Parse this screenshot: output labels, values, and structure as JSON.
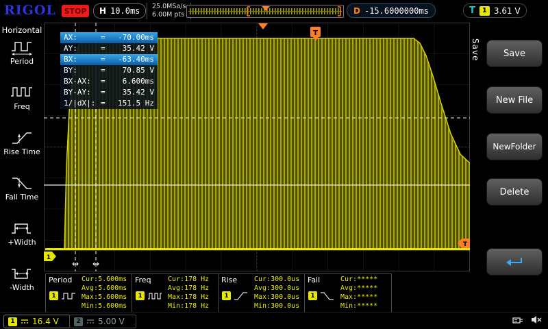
{
  "top_bar": {
    "logo": "RIGOL",
    "run_state": "STOP",
    "horizontal": {
      "label": "H",
      "timebase": "10.0ms"
    },
    "acquisition": {
      "sample_rate": "25.0MSa/s",
      "memory_depth": "6.00M pts"
    },
    "delay": {
      "label": "D",
      "value": "-15.6000000ms"
    },
    "trigger": {
      "label": "T",
      "source": "1",
      "level": "3.61 V"
    }
  },
  "left_menu": {
    "title": "Horizontal",
    "items": [
      {
        "label": "Period"
      },
      {
        "label": "Freq"
      },
      {
        "label": "Rise Time"
      },
      {
        "label": "Fall Time"
      },
      {
        "label": "+Width"
      },
      {
        "label": "-Width"
      }
    ]
  },
  "cursor_panel": {
    "rows": [
      {
        "label": "AX:",
        "eq": "=",
        "value": "-70.00ms",
        "highlight": true
      },
      {
        "label": "AY:",
        "eq": "=",
        "value": "35.42 V",
        "highlight": false
      },
      {
        "label": "BX:",
        "eq": "=",
        "value": "-63.40ms",
        "highlight": true
      },
      {
        "label": "BY:",
        "eq": "=",
        "value": "70.85 V",
        "highlight": false
      },
      {
        "label": "BX-AX:",
        "eq": "=",
        "value": "6.600ms",
        "highlight": false
      },
      {
        "label": "BY-AY:",
        "eq": "=",
        "value": "35.42 V",
        "highlight": false
      },
      {
        "label": "1/|dX|:",
        "eq": "=",
        "value": "151.5 Hz",
        "highlight": false
      }
    ]
  },
  "right_menu": {
    "tab": "Save",
    "items": [
      "Save",
      "New File",
      "NewFolder",
      "Delete"
    ]
  },
  "measurements": [
    {
      "name": "Period",
      "source": "1",
      "rows": [
        "Cur:5.600ms",
        "Avg:5.600ms",
        "Max:5.600ms",
        "Min:5.600ms"
      ]
    },
    {
      "name": "Freq",
      "source": "1",
      "rows": [
        "Cur:178 Hz",
        "Avg:178 Hz",
        "Max:178 Hz",
        "Min:178 Hz"
      ]
    },
    {
      "name": "Rise",
      "source": "1",
      "rows": [
        "Cur:300.0us",
        "Avg:300.0us",
        "Max:300.0us",
        "Min:300.0us"
      ]
    },
    {
      "name": "Fall",
      "source": "1",
      "rows": [
        "Cur:*****",
        "Avg:*****",
        "Max:*****",
        "Min:*****"
      ]
    }
  ],
  "status_bar": {
    "ch1": {
      "number": "1",
      "value": "16.4 V"
    },
    "ch2": {
      "number": "2",
      "value": "5.00 V"
    }
  },
  "markers": {
    "trigger_label": "T",
    "channel_label": "1"
  },
  "icons": {
    "double_arrow": "↔"
  },
  "colors": {
    "ch1_yellow": "#e6e600",
    "accent_orange": "#ff7f27",
    "highlight_blue": "#1787d8",
    "trigger_teal": "#1fc4c4",
    "stop_red": "#ee1c1c",
    "logo_blue": "#2b35d9"
  }
}
